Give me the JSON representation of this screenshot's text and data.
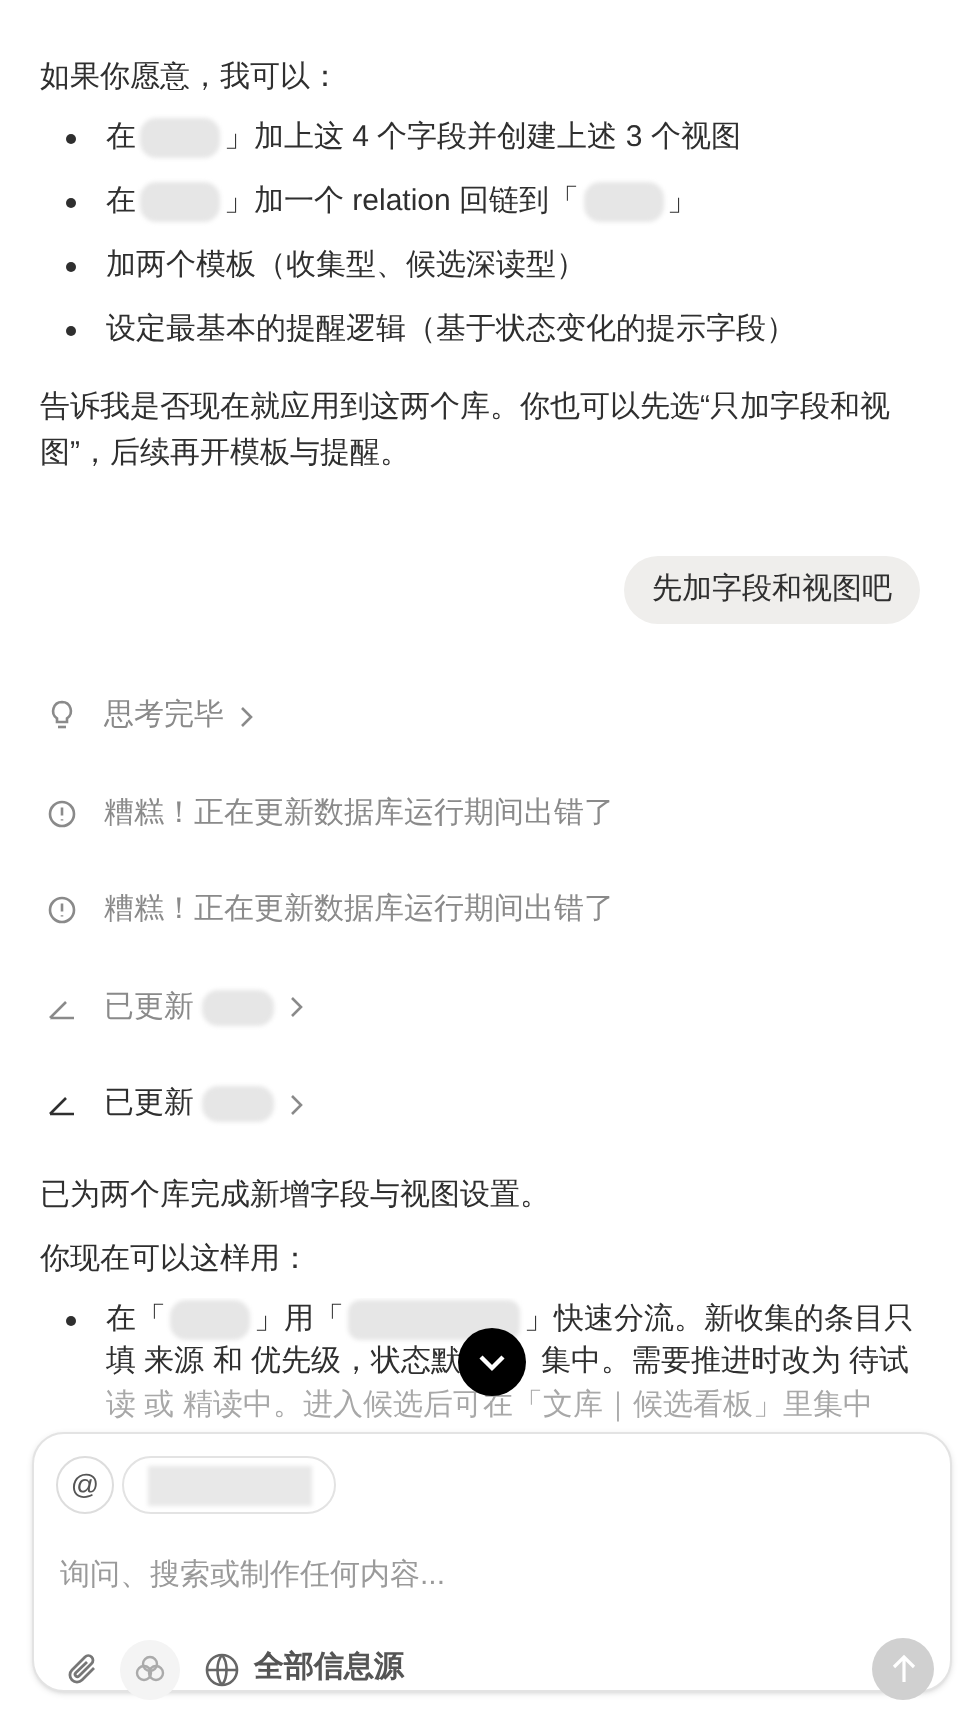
{
  "intro": "如果你愿意，我可以：",
  "options": [
    {
      "parts": [
        {
          "kind": "text",
          "text": "在"
        },
        {
          "kind": "redacted"
        },
        {
          "kind": "text",
          "text": "」加上这 4 个字段并创建上述 3 个视图"
        }
      ]
    },
    {
      "parts": [
        {
          "kind": "text",
          "text": "在"
        },
        {
          "kind": "redacted"
        },
        {
          "kind": "text",
          "text": "」加一个 relation 回链到「"
        },
        {
          "kind": "redacted"
        },
        {
          "kind": "text",
          "text": "」"
        }
      ]
    },
    {
      "parts": [
        {
          "kind": "text",
          "text": "加两个模板（收集型、候选深读型）"
        }
      ]
    },
    {
      "parts": [
        {
          "kind": "text",
          "text": "设定最基本的提醒逻辑（基于状态变化的提示字段）"
        }
      ]
    }
  ],
  "question": "告诉我是否现在就应用到这两个库。你也可以先选“只加字段和视图”，后续再开模板与提醒。",
  "user_message": "先加字段和视图吧",
  "steps": [
    {
      "kind": "thinking",
      "text": "思考完毕",
      "expandable": true,
      "active": false
    },
    {
      "kind": "error",
      "text": "糟糕！正在更新数据库运行期间出错了",
      "expandable": false,
      "active": false
    },
    {
      "kind": "error",
      "text": "糟糕！正在更新数据库运行期间出错了",
      "expandable": false,
      "active": false
    },
    {
      "kind": "updated",
      "text": "已更新",
      "redacted": true,
      "expandable": true,
      "active": false
    },
    {
      "kind": "updated",
      "text": "已更新",
      "redacted": true,
      "expandable": true,
      "active": true
    }
  ],
  "answer": "已为两个库完成新增字段与视图设置。",
  "usage_intro": "你现在可以这样用：",
  "usage": [
    {
      "lines": [
        {
          "faded": false,
          "parts": [
            {
              "kind": "text",
              "text": "在「"
            },
            {
              "kind": "redacted"
            },
            {
              "kind": "text",
              "text": "」用「"
            },
            {
              "kind": "redacted_long"
            },
            {
              "kind": "text",
              "text": "」快速分流。新收集的条目只"
            }
          ]
        },
        {
          "faded": false,
          "parts": [
            {
              "kind": "text",
              "text": "填 来源 和 优先级，状态默"
            },
            {
              "kind": "covered"
            },
            {
              "kind": "text",
              "text": "集中。需要推进时改为 待试"
            }
          ]
        },
        {
          "faded": true,
          "parts": [
            {
              "kind": "text",
              "text": "读 或 精读中。进入候选后可在「文库｜候选看板」里集中"
            }
          ]
        }
      ]
    }
  ],
  "composer": {
    "mention": "@",
    "context_chip_redacted": true,
    "placeholder": "询问、搜索或制作任何内容...",
    "sources": "全部信息源",
    "send_disabled": true
  }
}
